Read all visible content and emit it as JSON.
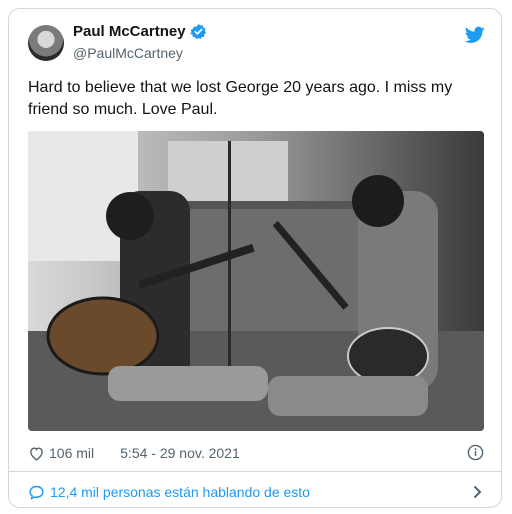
{
  "tweet": {
    "author_name": "Paul McCartney",
    "author_handle": "@PaulMcCartney",
    "text": "Hard to believe that we lost George 20 years ago.  I miss my\nfriend so much. Love Paul.",
    "likes": "106 mil",
    "timestamp": "5:54 - 29 nov. 2021",
    "conversation": "12,4 mil personas están hablando de esto"
  },
  "icons": {
    "verified": "verified-badge-icon",
    "platform": "twitter-bird-icon",
    "like": "heart-icon",
    "info": "info-icon",
    "reply": "speech-bubble-icon",
    "more": "chevron-right-icon"
  },
  "colors": {
    "accent": "#1d9bf0",
    "text": "#0f1419",
    "secondary": "#536471",
    "border": "#cfd9de"
  }
}
